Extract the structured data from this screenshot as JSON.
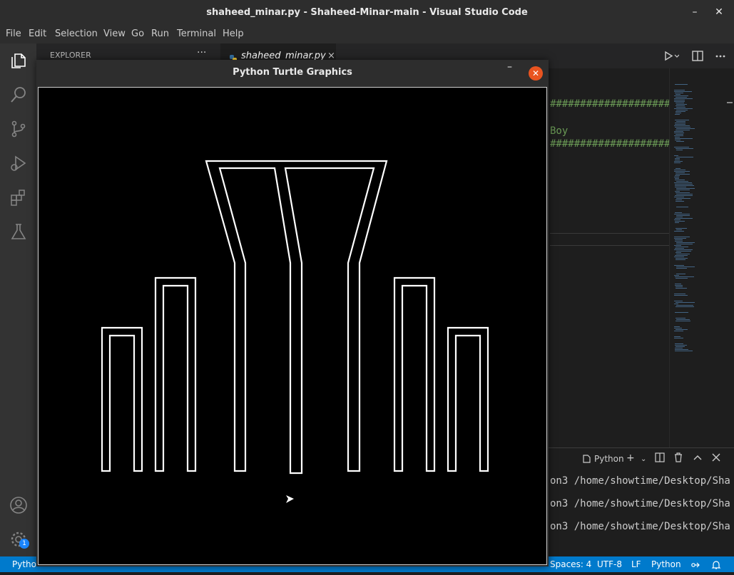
{
  "window": {
    "title": "shaheed_minar.py - Shaheed-Minar-main - Visual Studio Code",
    "minimize_glyph": "–",
    "close_glyph": "✕"
  },
  "menu": [
    "File",
    "Edit",
    "Selection",
    "View",
    "Go",
    "Run",
    "Terminal",
    "Help"
  ],
  "activity_bar": {
    "icons": [
      "explorer-icon",
      "search-icon",
      "source-control-icon",
      "run-debug-icon",
      "extensions-icon",
      "testing-icon",
      "account-icon",
      "settings-gear-icon"
    ],
    "settings_badge": "1"
  },
  "sidebar": {
    "header": "EXPLORER",
    "more": "···"
  },
  "tabs": [
    {
      "label": "shaheed_minar.py",
      "close": "×"
    }
  ],
  "editor_actions": [
    "run-icon",
    "split-editor-icon",
    "more-actions-icon"
  ],
  "editor": {
    "visible_lines": [
      "###########################",
      "Boy",
      "###########################"
    ]
  },
  "terminal": {
    "shell_label": "Python",
    "lines": [
      "on3 /home/showtime/Desktop/Sha",
      "on3 /home/showtime/Desktop/Sha",
      "on3 /home/showtime/Desktop/Sha"
    ]
  },
  "statusbar": {
    "left": "Pytho",
    "spaces": "Spaces: 4",
    "encoding": "UTF-8",
    "eol": "LF",
    "language": "Python"
  },
  "turtle_window": {
    "title": "Python Turtle Graphics",
    "minimize_glyph": "–",
    "close_glyph": "✕",
    "background": "#000000",
    "stroke": "#ffffff"
  },
  "colors": {
    "accent": "#007acc",
    "close_button": "#e95420",
    "comment_green": "#6a9955"
  }
}
